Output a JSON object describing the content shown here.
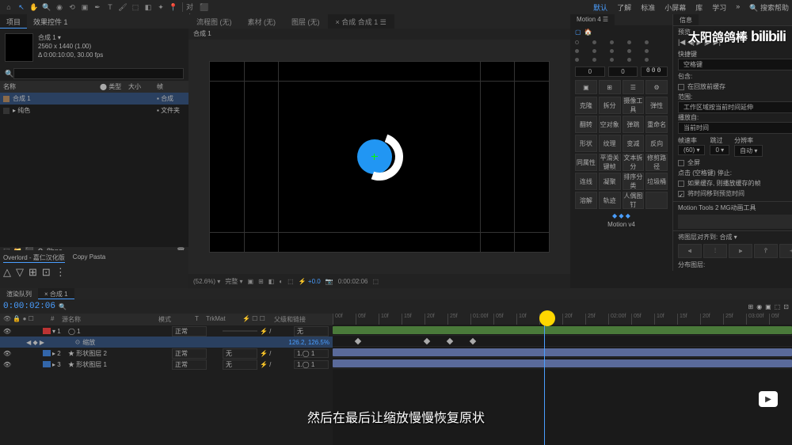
{
  "toolbar_menu": {
    "default": "默认",
    "learn": "了解",
    "standard": "标准",
    "small": "小屏幕",
    "lib": "库",
    "study": "学习",
    "search_placeholder": "搜索帮助"
  },
  "project": {
    "tabs": [
      "项目",
      "效果控件 1"
    ],
    "comp_name": "合成 1 ▾",
    "res": "2560 x 1440 (1.00)",
    "dur": "Δ 0:00:10:00, 30.00 fps",
    "search_placeholder": "",
    "headers": [
      "名称",
      "类型",
      "大小",
      "帧"
    ],
    "items": [
      {
        "name": "合成 1",
        "type": "合成",
        "color": "#8a6a4a"
      },
      {
        "name": "纯色",
        "type": "文件夹",
        "color": "#333"
      }
    ],
    "lower_tabs": [
      "Overlord - 嘉仁汉化版",
      "Copy Pasta"
    ]
  },
  "center": {
    "tabs": [
      "流程图 (无)",
      "素材 (无)",
      "图层 (无)",
      "合成 合成 1 ☰"
    ],
    "comp_bar": "合成 1",
    "controls": {
      "zoom": "(52.6%) ▾",
      "quality": "完整 ▾",
      "tc": "0:00:02:06",
      "exposure": "+0.0"
    }
  },
  "right": {
    "watermark_text": "太阳鸽鸽棒",
    "bili": "bilibili",
    "motion_tab": "Motion 4 ☰",
    "info_tab": "信息",
    "preview": "预览",
    "num1": "0",
    "num2": "0",
    "tc": "000",
    "grid1": [
      "克隆",
      "拆分",
      "摄像工具",
      "弹性"
    ],
    "grid2": [
      "翻转",
      "空对象",
      "弹跳",
      "重命名"
    ],
    "grid3": [
      "形状",
      "纹理",
      "变减",
      "反向"
    ],
    "grid4": [
      "同属性",
      "平滑关键帧",
      "文本拆分",
      "修剪路径"
    ],
    "grid5": [
      "连线",
      "凝聚",
      "排序分类",
      "垃圾桶"
    ],
    "grid6": [
      "溶解",
      "轨迹",
      "人偶图钉",
      ""
    ],
    "motion_v": "Motion v4",
    "shortcut": "快捷键",
    "spacebar": "空格键",
    "include": "包含:",
    "cache": "在回放前缓存",
    "range": "范围:",
    "range_val": "工作区域按当前时间延伸",
    "play_from": "播放自:",
    "play_val": "当前时间",
    "fps": "帧速率",
    "skip": "跳过",
    "res": "分辨率",
    "fps_val": "(60) ▾",
    "skip_val": "0 ▾",
    "res_val": "自动 ▾",
    "fullscreen": "全屏",
    "note": "点击 (空格键) 停止:",
    "cb1": "如果缓存, 则播放缓存的帧",
    "cb2": "将时间移到预览时间",
    "mt2": "Motion Tools 2 MG动画工具",
    "align": "将图层对齐到: 合成 ▾",
    "dist": "分布图层:"
  },
  "timeline": {
    "tabs": [
      "渲染队列",
      "合成 1"
    ],
    "timecode": "0:00:02:06",
    "header_cols": [
      "源名称",
      "模式",
      "T",
      "TrkMat",
      "父级和链接"
    ],
    "layers": [
      {
        "idx": "1",
        "name": "◯ 1",
        "color": "#b33",
        "mode": "正常",
        "trk": "",
        "parent": "无",
        "sel": false
      },
      {
        "idx": "",
        "name": "缩放",
        "color": "",
        "scale": "126.2, 126.5%",
        "prop": true,
        "sel": true
      },
      {
        "idx": "2",
        "name": "★ 形状图层 2",
        "color": "#36a",
        "mode": "正常",
        "trk": "无",
        "parent": "1.◯ 1",
        "sel": false
      },
      {
        "idx": "3",
        "name": "★ 形状图层 1",
        "color": "#36a",
        "mode": "正常",
        "trk": "无",
        "parent": "1.◯ 1",
        "sel": false
      }
    ],
    "ruler": [
      "00f",
      "05f",
      "10f",
      "15f",
      "20f",
      "25f",
      "01:00f",
      "05f",
      "10f",
      "15f",
      "20f",
      "25f",
      "02:00f",
      "05f",
      "10f",
      "15f",
      "20f",
      "25f",
      "03:00f",
      "05f"
    ]
  },
  "subtitle": "然后在最后让缩放慢慢恢复原状"
}
